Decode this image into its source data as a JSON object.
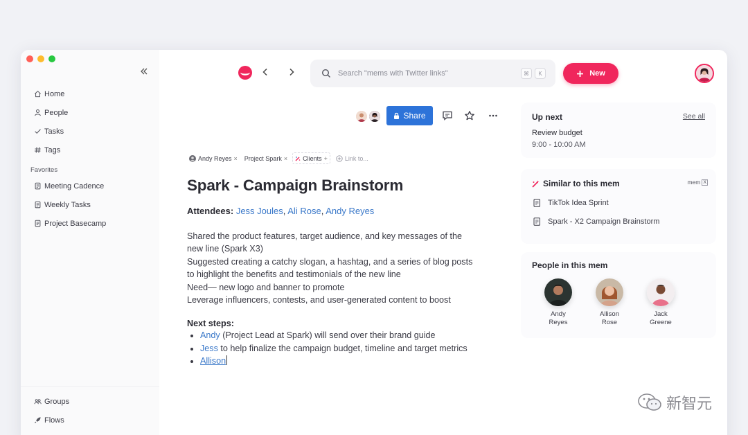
{
  "sidebar": {
    "nav": [
      {
        "label": "Home",
        "icon": "home-icon"
      },
      {
        "label": "People",
        "icon": "person-icon"
      },
      {
        "label": "Tasks",
        "icon": "check-icon"
      },
      {
        "label": "Tags",
        "icon": "hash-icon"
      }
    ],
    "favorites_label": "Favorites",
    "favorites": [
      {
        "label": "Meeting Cadence",
        "icon": "document-icon"
      },
      {
        "label": "Weekly Tasks",
        "icon": "document-icon"
      },
      {
        "label": "Project Basecamp",
        "icon": "document-icon"
      }
    ],
    "bottom": [
      {
        "label": "Groups",
        "icon": "groups-icon"
      },
      {
        "label": "Flows",
        "icon": "rocket-icon"
      }
    ]
  },
  "topbar": {
    "search_placeholder": "Search \"mems with Twitter links\"",
    "kbd_cmd": "⌘",
    "kbd_k": "K",
    "new_label": "New",
    "accent": "#f0265c"
  },
  "toolbar": {
    "share_label": "Share",
    "share_color": "#2d73d9"
  },
  "chips": {
    "person": "Andy Reyes",
    "project": "Project Spark",
    "clients": "Clients",
    "link_to": "Link to..."
  },
  "doc": {
    "title": "Spark - Campaign Brainstorm",
    "attendees_label": "Attendees:",
    "attendee_1": "Jess Joules",
    "attendee_2": "Ali Rose",
    "attendee_3": "Andy Reyes",
    "sep": ",",
    "lines": [
      "Shared the product features, target audience, and key messages of the",
      "new line (Spark X3)",
      "Suggested creating a catchy slogan, a hashtag, and a series of blog posts",
      "to highlight the benefits and testimonials of the new line",
      "Need— new logo and banner to promote",
      "Leverage influencers, contests, and user-generated content to boost"
    ],
    "next_label": "Next steps:",
    "step_1_name": "Andy",
    "step_1_text": " (Project Lead at Spark) will send over their brand guide",
    "step_2_name": "Jess",
    "step_2_text": " to help finalize the campaign budget, timeline and target metrics",
    "step_3_name": "Allison"
  },
  "upnext": {
    "title": "Up next",
    "see_all": "See all",
    "event_title": "Review budget",
    "event_time": "9:00 - 10:00 AM"
  },
  "similar": {
    "title": "Similar to this mem",
    "badge": "mem",
    "items": [
      "TikTok Idea Sprint",
      "Spark - X2 Campaign Brainstorm"
    ]
  },
  "people": {
    "title": "People in this mem",
    "list": [
      {
        "first": "Andy",
        "last": "Reyes"
      },
      {
        "first": "Allison",
        "last": "Rose"
      },
      {
        "first": "Jack",
        "last": "Greene"
      }
    ]
  },
  "watermark": {
    "text": "新智元"
  }
}
